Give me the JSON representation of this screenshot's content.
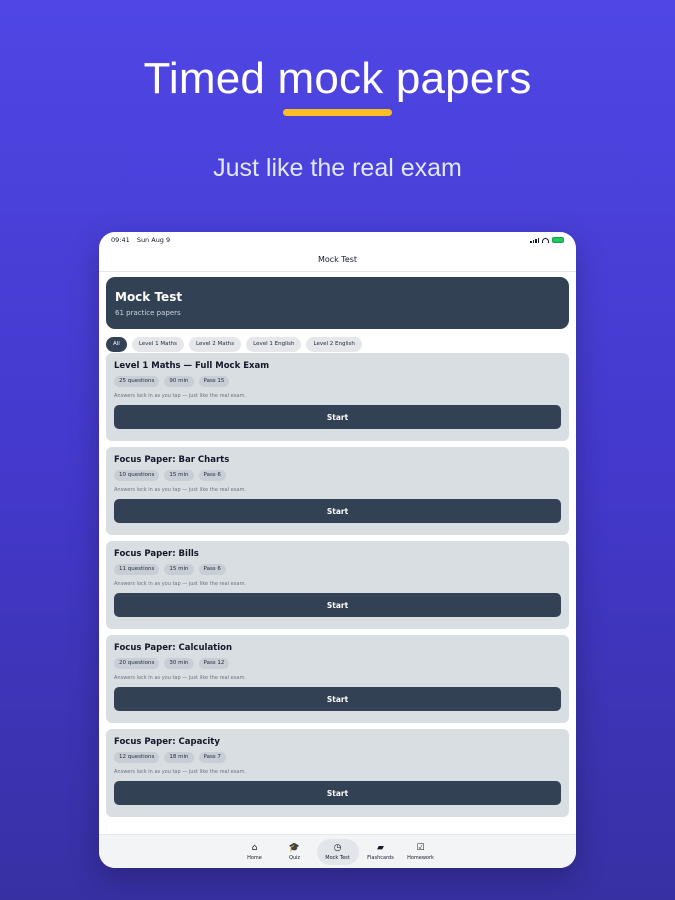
{
  "hero": {
    "title": "Timed mock papers",
    "subtitle": "Just like the real exam"
  },
  "status": {
    "time": "09:41",
    "date": "Sun Aug 9"
  },
  "nav": {
    "title": "Mock Test"
  },
  "banner": {
    "title": "Mock Test",
    "subtitle": "61 practice papers"
  },
  "filters": [
    {
      "label": "All",
      "active": true
    },
    {
      "label": "Level 1 Maths",
      "active": false
    },
    {
      "label": "Level 2 Maths",
      "active": false
    },
    {
      "label": "Level 1 English",
      "active": false
    },
    {
      "label": "Level 2 English",
      "active": false
    }
  ],
  "papers": [
    {
      "title": "Level 1 Maths — Full Mock Exam",
      "questions": "25 questions",
      "time": "90 min",
      "pass": "Pass 15",
      "note": "Answers lock in as you tap — just like the real exam.",
      "button": "Start"
    },
    {
      "title": "Focus Paper: Bar Charts",
      "questions": "10 questions",
      "time": "15 min",
      "pass": "Pass 6",
      "note": "Answers lock in as you tap — just like the real exam.",
      "button": "Start"
    },
    {
      "title": "Focus Paper: Bills",
      "questions": "11 questions",
      "time": "15 min",
      "pass": "Pass 6",
      "note": "Answers lock in as you tap — just like the real exam.",
      "button": "Start"
    },
    {
      "title": "Focus Paper: Calculation",
      "questions": "20 questions",
      "time": "30 min",
      "pass": "Pass 12",
      "note": "Answers lock in as you tap — just like the real exam.",
      "button": "Start"
    },
    {
      "title": "Focus Paper: Capacity",
      "questions": "12 questions",
      "time": "18 min",
      "pass": "Pass 7",
      "note": "Answers lock in as you tap — just like the real exam.",
      "button": "Start"
    }
  ],
  "tabs": [
    {
      "label": "Home",
      "icon": "home-icon",
      "glyph": "⌂",
      "active": false
    },
    {
      "label": "Quiz",
      "icon": "graduation-cap-icon",
      "glyph": "🎓",
      "active": false
    },
    {
      "label": "Mock Test",
      "icon": "stopwatch-icon",
      "glyph": "◷",
      "active": true
    },
    {
      "label": "Flashcards",
      "icon": "card-stack-icon",
      "glyph": "▰",
      "active": false
    },
    {
      "label": "Homework",
      "icon": "checkbox-icon",
      "glyph": "☑",
      "active": false
    }
  ],
  "colors": {
    "background": "#4f46e5",
    "accent_underline": "#fbbf24",
    "card_dark": "#334155",
    "card_light": "#d9dee3"
  }
}
